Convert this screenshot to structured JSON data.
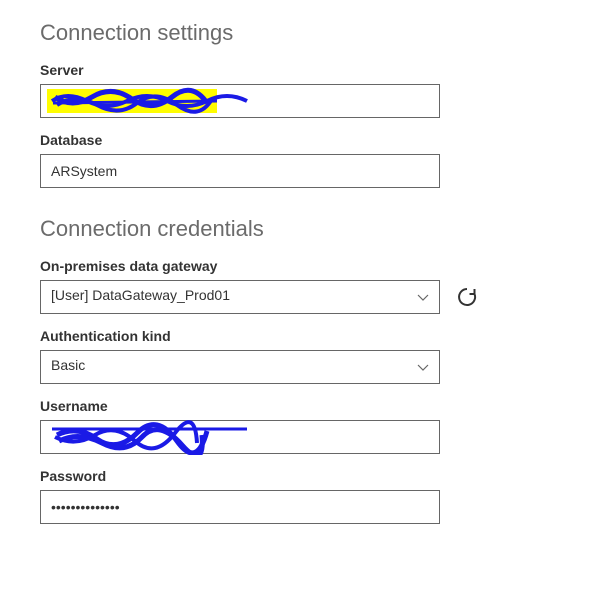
{
  "settings": {
    "heading": "Connection settings",
    "serverLabel": "Server",
    "serverValue": "",
    "databaseLabel": "Database",
    "databaseValue": "ARSystem"
  },
  "credentials": {
    "heading": "Connection credentials",
    "gatewayLabel": "On-premises data gateway",
    "gatewayValue": "[User] DataGateway_Prod01",
    "authKindLabel": "Authentication kind",
    "authKindValue": "Basic",
    "usernameLabel": "Username",
    "usernameValue": "",
    "passwordLabel": "Password",
    "passwordValue": "••••••••••••••"
  }
}
